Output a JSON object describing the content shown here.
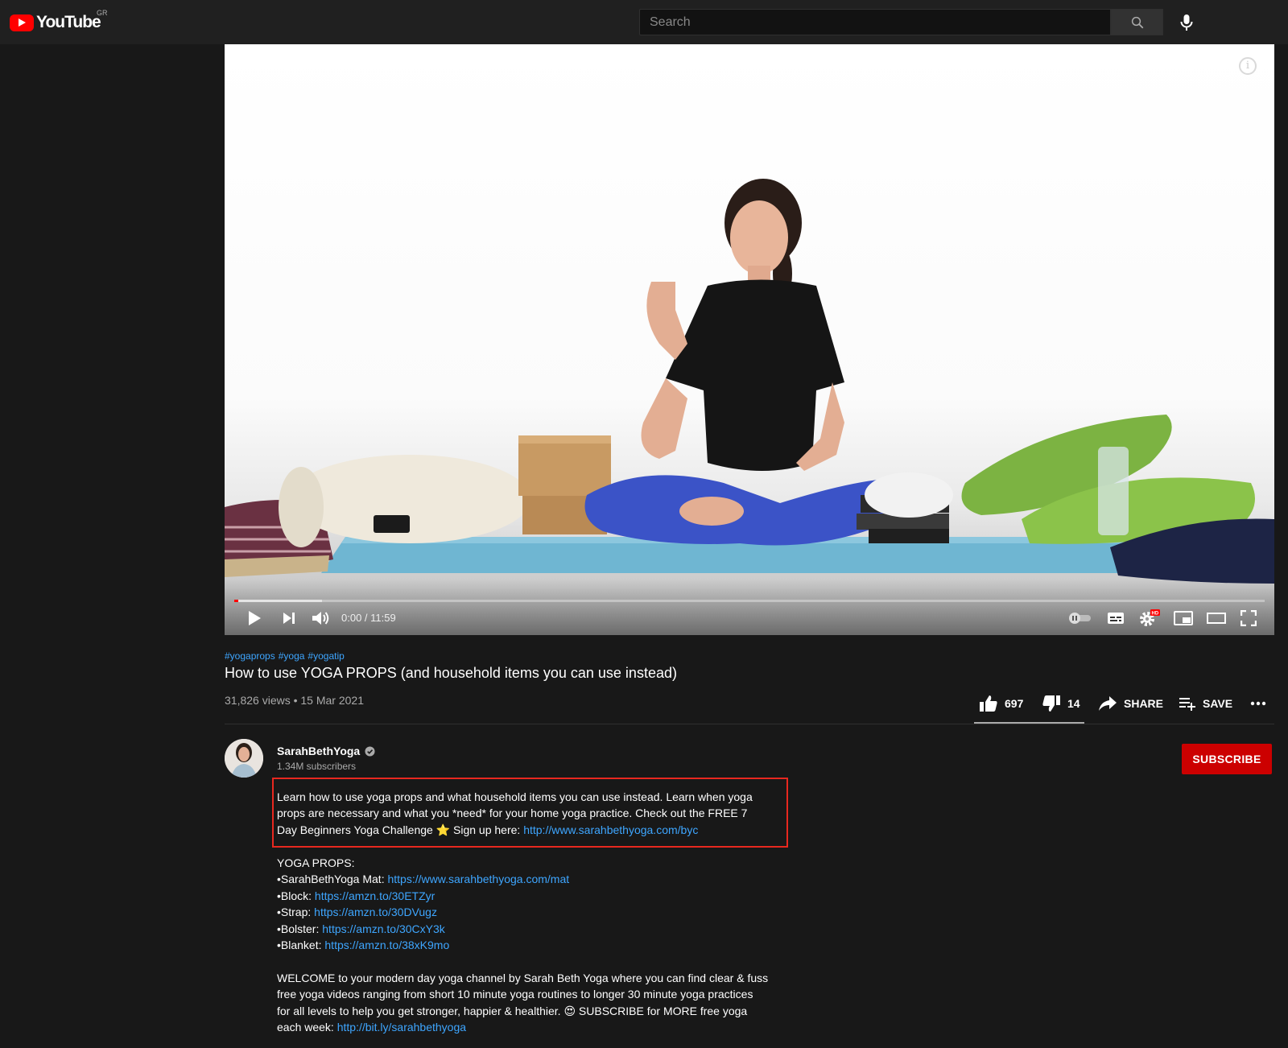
{
  "masthead": {
    "logo_text": "YouTube",
    "country_code": "GR",
    "search_placeholder": "Search"
  },
  "player": {
    "time_display": "0:00 / 11:59",
    "progress_fraction": 0.0,
    "buffered_fraction": 0.085
  },
  "video": {
    "hashtags": [
      "#yogaprops",
      "#yoga",
      "#yogatip"
    ],
    "title": "How to use YOGA PROPS (and household items you can use instead)",
    "meta": "31,826 views • 15 Mar 2021",
    "likes": "697",
    "dislikes": "14",
    "share_label": "SHARE",
    "save_label": "SAVE"
  },
  "channel": {
    "name": "SarahBethYoga",
    "subscribers": "1.34M subscribers",
    "subscribe_label": "SUBSCRIBE"
  },
  "description": {
    "intro_lines": [
      "Learn how to use yoga props and what household items you can use instead. Learn when yoga",
      "props are necessary and what you *need* for your home yoga practice. Check out the FREE 7"
    ],
    "intro_line3_prefix": "Day Beginners Yoga Challenge ⭐ Sign up here: ",
    "intro_link": "http://www.sarahbethyoga.com/byc",
    "props_heading": "YOGA PROPS:",
    "props": [
      {
        "label": "•SarahBethYoga Mat: ",
        "link": "https://www.sarahbethyoga.com/mat"
      },
      {
        "label": "•Block: ",
        "link": "https://amzn.to/30ETZyr"
      },
      {
        "label": "•Strap: ",
        "link": "https://amzn.to/30DVugz"
      },
      {
        "label": "•Bolster: ",
        "link": "https://amzn.to/30CxY3k"
      },
      {
        "label": "•Blanket: ",
        "link": "https://amzn.to/38xK9mo"
      }
    ],
    "welcome_lines": [
      "WELCOME to your modern day yoga channel by Sarah Beth Yoga where you can find clear & fuss",
      "free yoga videos ranging from short 10 minute yoga routines to longer 30 minute yoga practices",
      "for all levels to help you get stronger, happier & healthier. 😍 SUBSCRIBE for MORE free yoga"
    ],
    "welcome_line4_prefix": "each week: ",
    "welcome_link": "http://bit.ly/sarahbethyoga"
  }
}
